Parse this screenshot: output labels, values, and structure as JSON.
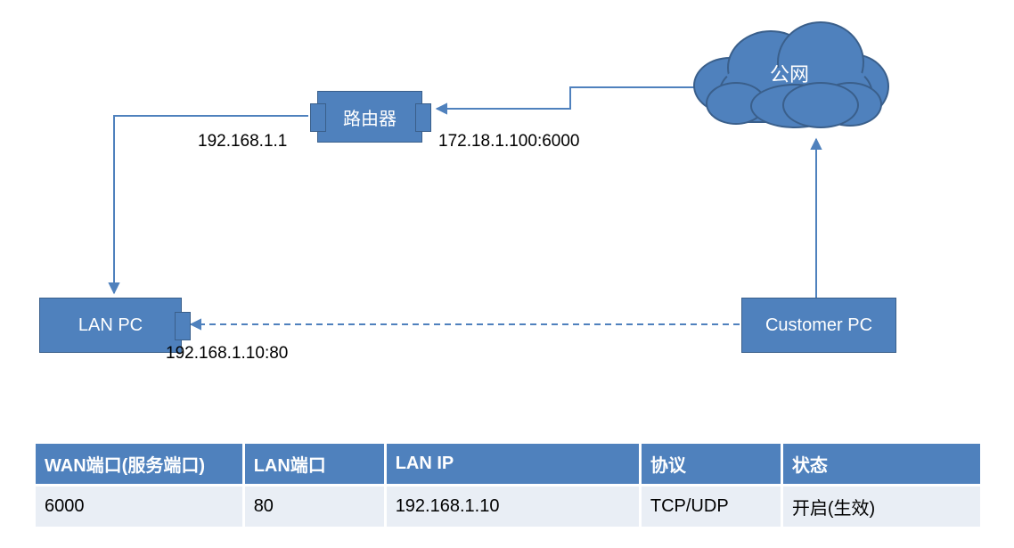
{
  "diagram": {
    "cloud_label": "公网",
    "router_label": "路由器",
    "lan_pc_label": "LAN PC",
    "customer_pc_label": "Customer PC",
    "router_lan_ip": "192.168.1.1",
    "router_wan_addr": "172.18.1.100:6000",
    "lan_pc_addr": "192.168.1.10:80"
  },
  "table": {
    "headers": {
      "wan_port": "WAN端口(服务端口)",
      "lan_port": "LAN端口",
      "lan_ip": "LAN IP",
      "protocol": "协议",
      "status": "状态"
    },
    "row": {
      "wan_port": "6000",
      "lan_port": "80",
      "lan_ip": "192.168.1.10",
      "protocol": "TCP/UDP",
      "status": "开启(生效)"
    }
  }
}
